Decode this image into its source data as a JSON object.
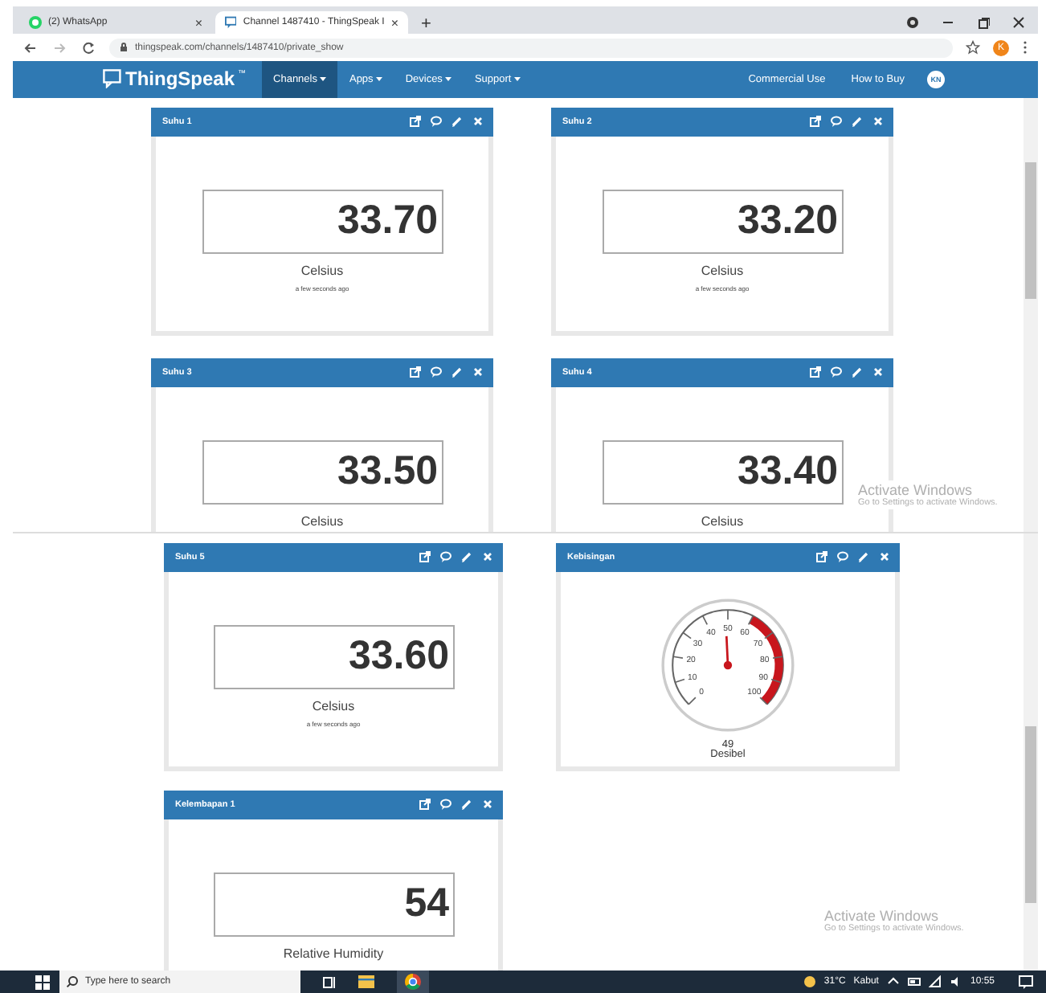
{
  "browser": {
    "tabs": [
      {
        "title": "(2) WhatsApp",
        "close": "×",
        "selected": false
      },
      {
        "title": "Channel 1487410 - ThingSpeak I",
        "close": "×",
        "selected": true
      }
    ],
    "new_tab": "+",
    "url": "thingspeak.com/channels/1487410/private_show",
    "profile": "K"
  },
  "navbar": {
    "logo": "ThingSpeak",
    "trademark": "™",
    "menus": [
      {
        "label": "Channels",
        "selected": true
      },
      {
        "label": "Apps",
        "selected": false
      },
      {
        "label": "Devices",
        "selected": false
      },
      {
        "label": "Support",
        "selected": false
      }
    ],
    "links": [
      "Commercial Use",
      "How to Buy"
    ],
    "avatar": "KN"
  },
  "sections": [
    {
      "widgets": [
        {
          "kind": "number",
          "title": "Suhu 1",
          "value": "33.70",
          "unit": "Celsius",
          "updated": "a few seconds ago"
        },
        {
          "kind": "number",
          "title": "Suhu 2",
          "value": "33.20",
          "unit": "Celsius",
          "updated": "a few seconds ago"
        },
        {
          "kind": "number",
          "title": "Suhu 3",
          "value": "33.50",
          "unit": "Celsius"
        },
        {
          "kind": "number",
          "title": "Suhu 4",
          "value": "33.40",
          "unit": "Celsius"
        }
      ],
      "notice": {
        "title": "Activate Windows",
        "hint": "Go to Settings to activate Windows."
      }
    },
    {
      "widgets": [
        {
          "kind": "number",
          "title": "Suhu 5",
          "value": "33.60",
          "unit": "Celsius",
          "updated": "a few seconds ago"
        },
        {
          "kind": "gauge",
          "title": "Kebisingan",
          "ticks": [
            "0",
            "10",
            "20",
            "30",
            "40",
            "50",
            "60",
            "70",
            "80",
            "90",
            "100"
          ],
          "level": 0.49,
          "value": "49",
          "unit": "Desibel"
        },
        {
          "kind": "number",
          "title": "Kelembapan 1",
          "value": "54",
          "unit": "Relative Humidity"
        }
      ],
      "notice": {
        "title": "Activate Windows",
        "hint": "Go to Settings to activate Windows."
      }
    }
  ],
  "taskbar": {
    "search_placeholder": "Type here to search",
    "temperature": "31°C",
    "weather": "Kabut",
    "time": "10:55"
  }
}
